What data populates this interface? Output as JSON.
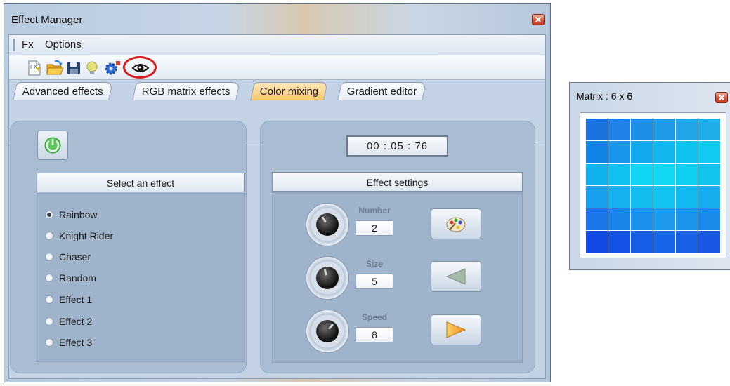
{
  "effect_manager": {
    "title": "Effect Manager",
    "menu": {
      "fx": "Fx",
      "options": "Options"
    },
    "toolbar_icons": [
      "new-effect-icon",
      "open-folder-icon",
      "save-icon",
      "lightbulb-icon",
      "settings-gear-icon",
      "eye-preview-icon"
    ],
    "highlighted_icon": "eye-preview-icon",
    "tabs": [
      {
        "label": "Advanced effects",
        "active": false
      },
      {
        "label": "RGB matrix effects",
        "active": false
      },
      {
        "label": "Color mixing",
        "active": true
      },
      {
        "label": "Gradient editor",
        "active": false
      }
    ],
    "select_effect": {
      "header": "Select an effect",
      "options": [
        "Rainbow",
        "Knight Rider",
        "Chaser",
        "Random",
        "Effect 1",
        "Effect 2",
        "Effect 3"
      ],
      "selected": "Rainbow"
    },
    "timer": "00 : 05 : 76",
    "effect_settings": {
      "header": "Effect settings",
      "params": [
        {
          "label": "Number",
          "value": "2"
        },
        {
          "label": "Size",
          "value": "5"
        },
        {
          "label": "Speed",
          "value": "8"
        }
      ],
      "buttons": [
        "color-palette-icon",
        "play-backward-icon",
        "play-forward-icon"
      ]
    }
  },
  "matrix_window": {
    "title": "Matrix : 6 x 6",
    "rows": 6,
    "cols": 6,
    "cell_colors": [
      [
        "#1a74e0",
        "#1e82e6",
        "#1e8fe6",
        "#1f9ae6",
        "#1fa5e8",
        "#20aeea"
      ],
      [
        "#1284e8",
        "#1896ec",
        "#12a8ec",
        "#10b8ee",
        "#0fc3ef",
        "#12c9ef"
      ],
      [
        "#0fb0ee",
        "#10c2f0",
        "#0fd6f2",
        "#0ed8f2",
        "#0fd0f0",
        "#10c4ee"
      ],
      [
        "#18a0ee",
        "#14b0ef",
        "#12bdf0",
        "#10c4f0",
        "#10baee",
        "#16aeec"
      ],
      [
        "#1a78ea",
        "#1a86ec",
        "#1c92ec",
        "#1d9aec",
        "#1c94ec",
        "#1b8aea"
      ],
      [
        "#1248e6",
        "#1452e6",
        "#165ee6",
        "#1866e8",
        "#1860e6",
        "#1858e4"
      ]
    ]
  },
  "colors": {
    "active_tab": "#f7c86e",
    "highlight_circle": "#d81c1c",
    "panel_bg": "#a9bcd2"
  }
}
